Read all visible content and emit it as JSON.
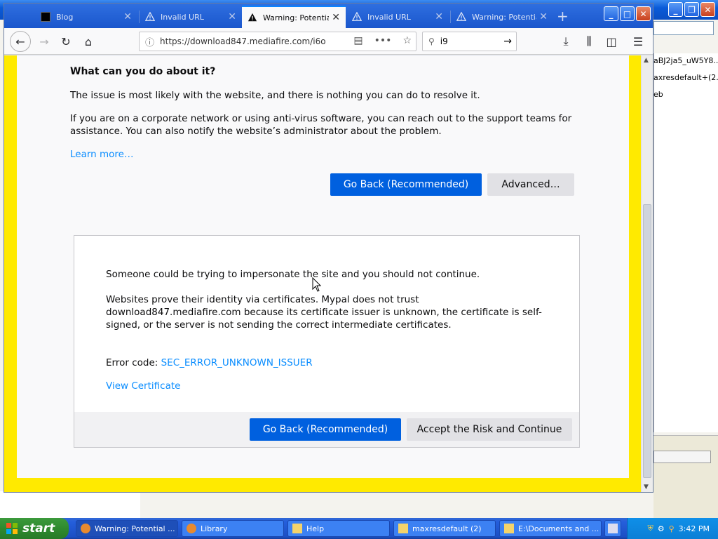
{
  "background_window": {
    "files": [
      "aBJ2ja5_uW5Y8...",
      "axresdefault+(2...",
      "eb"
    ]
  },
  "tabs": [
    {
      "title": "Blog",
      "icon": "blog-favicon",
      "active": false
    },
    {
      "title": "Invalid URL",
      "icon": "warning-icon",
      "active": false
    },
    {
      "title": "Warning: Potential",
      "icon": "warning-icon",
      "active": true
    },
    {
      "title": "Invalid URL",
      "icon": "warning-icon",
      "active": false
    },
    {
      "title": "Warning: Potential",
      "icon": "warning-icon",
      "active": false
    }
  ],
  "navbar": {
    "url": "https://download847.mediafire.com/i6o",
    "search_value": "i9"
  },
  "page": {
    "heading": "What can you do about it?",
    "p1": "The issue is most likely with the website, and there is nothing you can do to resolve it.",
    "p2": "If you are on a corporate network or using anti-virus software, you can reach out to the support teams for assistance. You can also notify the website’s administrator about the problem.",
    "learn_more": "Learn more…",
    "go_back_label": "Go Back (Recommended)",
    "advanced_label": "Advanced…"
  },
  "details": {
    "line1": "Someone could be trying to impersonate the site and you should not continue.",
    "line2": "Websites prove their identity via certificates. Mypal does not trust download847.mediafire.com because its certificate issuer is unknown, the certificate is self-signed, or the server is not sending the correct intermediate certificates.",
    "error_prefix": "Error code: ",
    "error_code": "SEC_ERROR_UNKNOWN_ISSUER",
    "view_certificate": "View Certificate",
    "go_back_label": "Go Back (Recommended)",
    "accept_label": "Accept the Risk and Continue"
  },
  "taskbar": {
    "start_label": "start",
    "tasks": [
      {
        "label": "Warning: Potential ...",
        "active": true
      },
      {
        "label": "Library",
        "active": false
      },
      {
        "label": "Help",
        "active": false
      },
      {
        "label": "maxresdefault (2)",
        "active": false
      },
      {
        "label": "E:\\Documents and ...",
        "active": false
      }
    ],
    "clock": "3:42 PM"
  },
  "colors": {
    "accent_blue": "#0060df",
    "link_blue": "#0a8dff",
    "page_border_yellow": "#ffea00"
  }
}
